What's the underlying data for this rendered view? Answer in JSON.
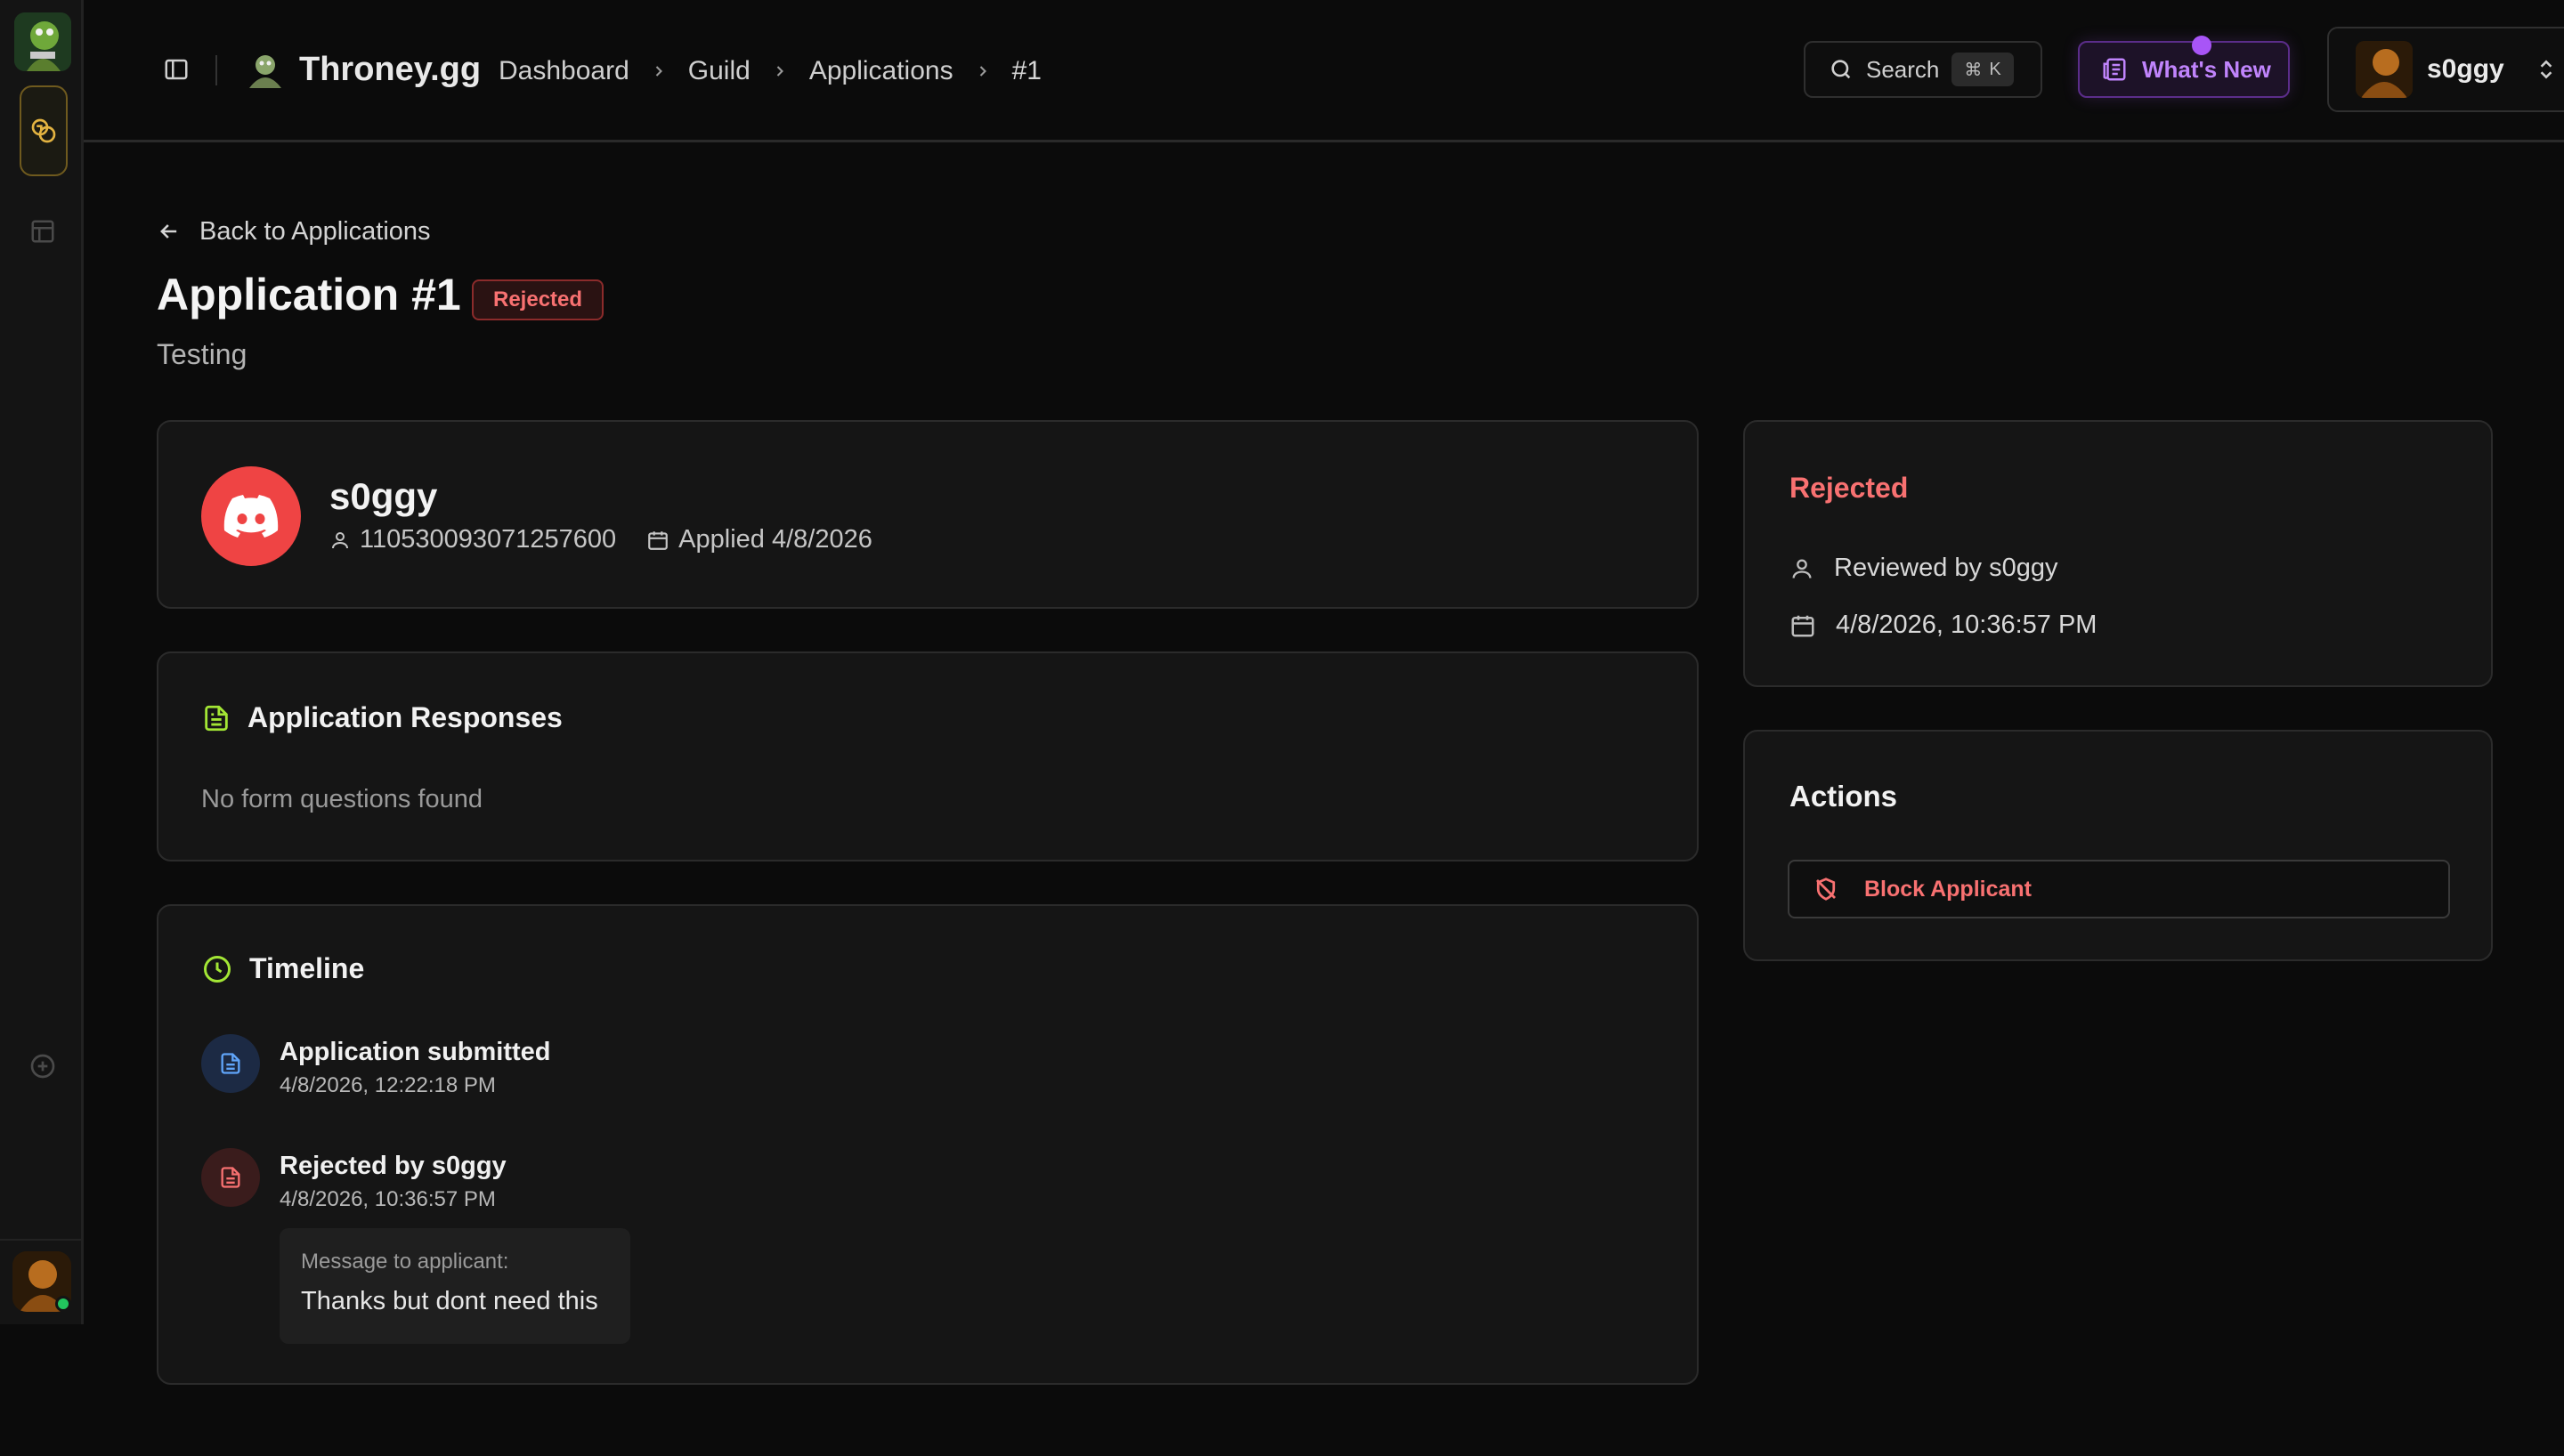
{
  "app": {
    "name": "Throney.gg"
  },
  "breadcrumb": [
    "Dashboard",
    "Guild",
    "Applications",
    "#1"
  ],
  "header": {
    "search_label": "Search",
    "search_shortcut_symbol": "⌘",
    "search_shortcut_key": "K",
    "whats_new_label": "What's New",
    "user_name": "s0ggy"
  },
  "page": {
    "back_label": "Back to Applications",
    "title": "Application #1",
    "status": "Rejected",
    "subtitle": "Testing"
  },
  "applicant": {
    "name": "s0ggy",
    "user_id": "110530093071257600",
    "applied": "Applied 4/8/2026"
  },
  "responses": {
    "heading": "Application Responses",
    "empty_text": "No form questions found"
  },
  "timeline": {
    "heading": "Timeline",
    "events": [
      {
        "title": "Application submitted",
        "time": "4/8/2026, 12:22:18 PM"
      },
      {
        "title": "Rejected by s0ggy",
        "time": "4/8/2026, 10:36:57 PM",
        "message_label": "Message to applicant:",
        "message": "Thanks but dont need this"
      }
    ]
  },
  "review": {
    "status": "Rejected",
    "reviewed_by": "Reviewed by s0ggy",
    "reviewed_at": "4/8/2026, 10:36:57 PM"
  },
  "actions": {
    "title": "Actions",
    "block_label": "Block Applicant"
  },
  "colors": {
    "accent_green": "#a3e635",
    "danger": "#f87171",
    "purple": "#a855f7",
    "discord_red": "#ef4444"
  }
}
